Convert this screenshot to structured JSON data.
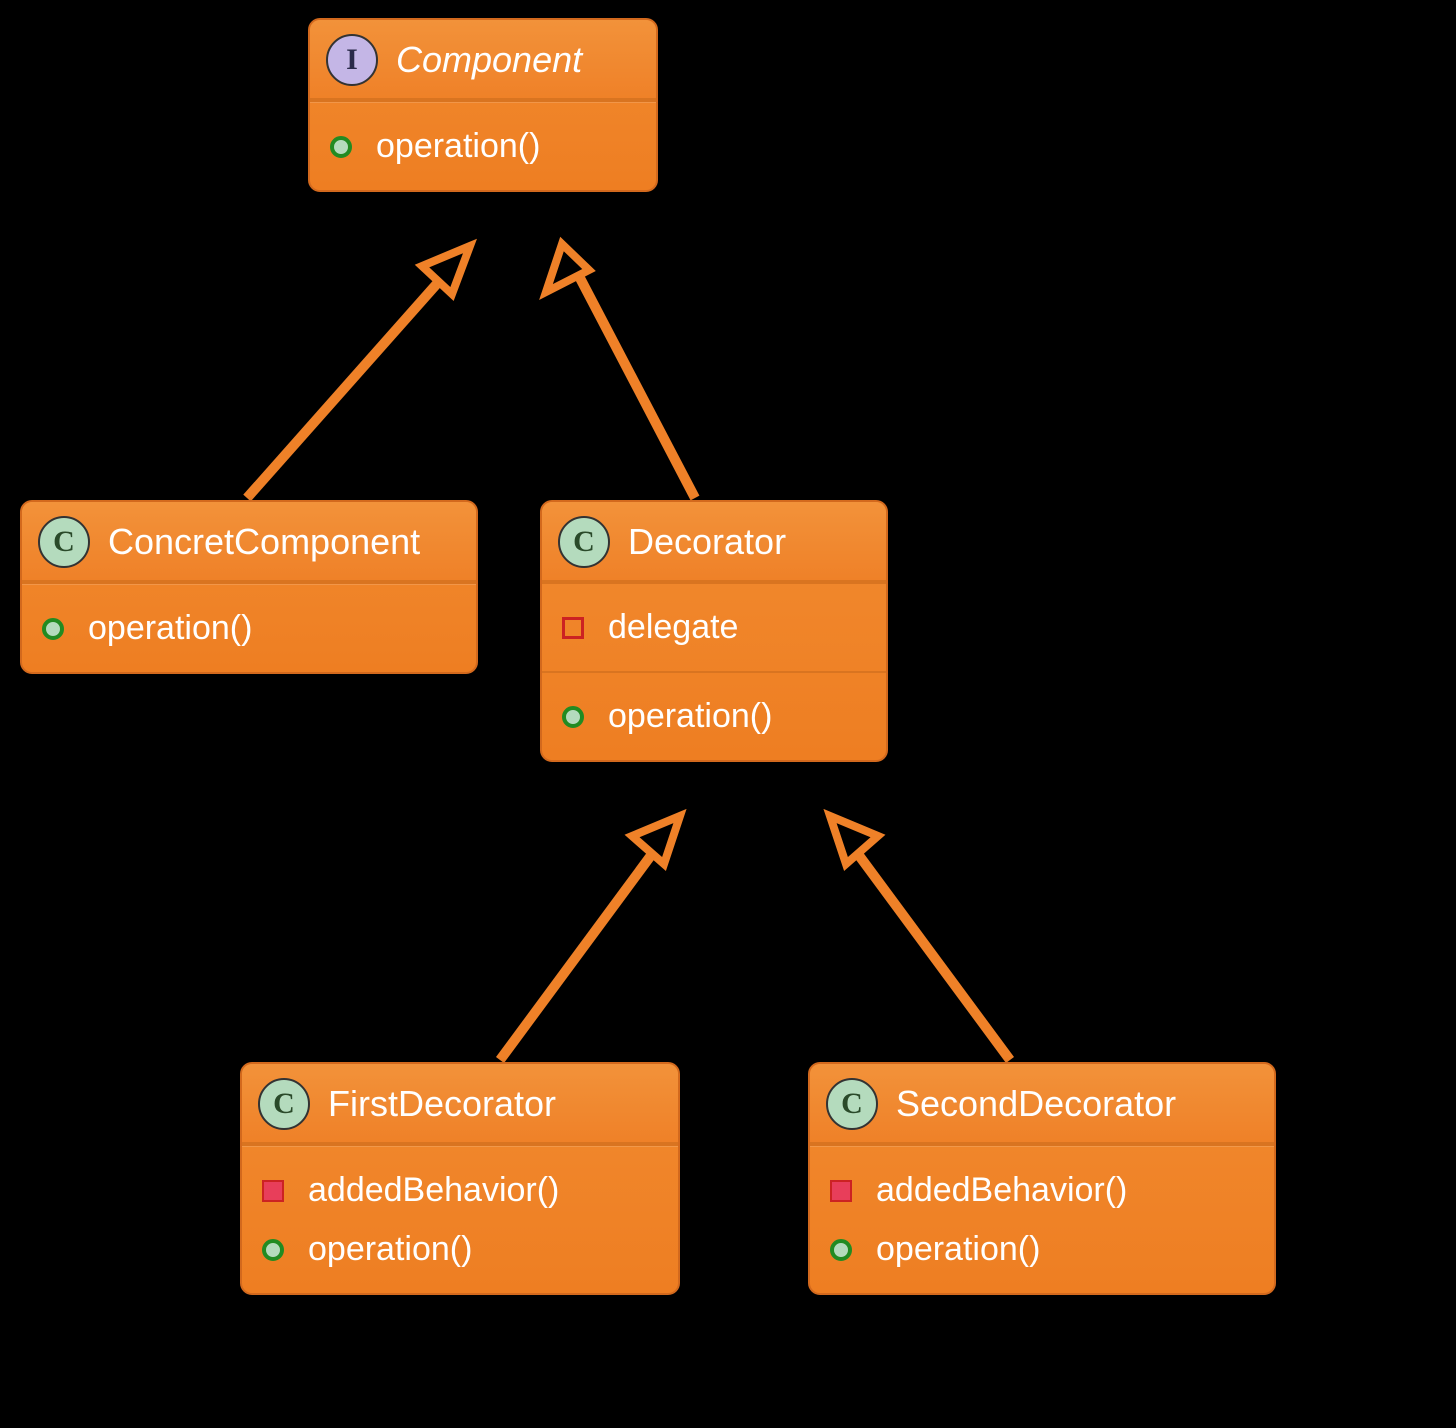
{
  "classes": {
    "component": {
      "name": "Component",
      "stereotype": "I",
      "members": [
        {
          "vis": "public",
          "label": "operation()"
        }
      ]
    },
    "concreteComponent": {
      "name": "ConcretComponent",
      "stereotype": "C",
      "members": [
        {
          "vis": "public",
          "label": "operation()"
        }
      ]
    },
    "decorator": {
      "name": "Decorator",
      "stereotype": "C",
      "attributes": [
        {
          "vis": "private-open",
          "label": "delegate"
        }
      ],
      "members": [
        {
          "vis": "public",
          "label": "operation()"
        }
      ]
    },
    "firstDecorator": {
      "name": "FirstDecorator",
      "stereotype": "C",
      "members": [
        {
          "vis": "private-filled",
          "label": "addedBehavior()"
        },
        {
          "vis": "public",
          "label": "operation()"
        }
      ]
    },
    "secondDecorator": {
      "name": "SecondDecorator",
      "stereotype": "C",
      "members": [
        {
          "vis": "private-filled",
          "label": "addedBehavior()"
        },
        {
          "vis": "public",
          "label": "operation()"
        }
      ]
    }
  },
  "relations": [
    {
      "from": "concreteComponent",
      "to": "component",
      "type": "realization"
    },
    {
      "from": "decorator",
      "to": "component",
      "type": "realization"
    },
    {
      "from": "firstDecorator",
      "to": "decorator",
      "type": "generalization"
    },
    {
      "from": "secondDecorator",
      "to": "decorator",
      "type": "generalization"
    }
  ],
  "chart_data": {
    "type": "uml-class-diagram",
    "pattern": "Decorator",
    "nodes": [
      {
        "id": "Component",
        "kind": "interface",
        "operations": [
          "operation()"
        ]
      },
      {
        "id": "ConcretComponent",
        "kind": "class",
        "operations": [
          "operation()"
        ]
      },
      {
        "id": "Decorator",
        "kind": "class",
        "attributes": [
          "delegate"
        ],
        "operations": [
          "operation()"
        ]
      },
      {
        "id": "FirstDecorator",
        "kind": "class",
        "operations": [
          "addedBehavior()",
          "operation()"
        ]
      },
      {
        "id": "SecondDecorator",
        "kind": "class",
        "operations": [
          "addedBehavior()",
          "operation()"
        ]
      }
    ],
    "edges": [
      {
        "from": "ConcretComponent",
        "to": "Component",
        "relation": "implements"
      },
      {
        "from": "Decorator",
        "to": "Component",
        "relation": "implements"
      },
      {
        "from": "FirstDecorator",
        "to": "Decorator",
        "relation": "extends"
      },
      {
        "from": "SecondDecorator",
        "to": "Decorator",
        "relation": "extends"
      }
    ]
  }
}
